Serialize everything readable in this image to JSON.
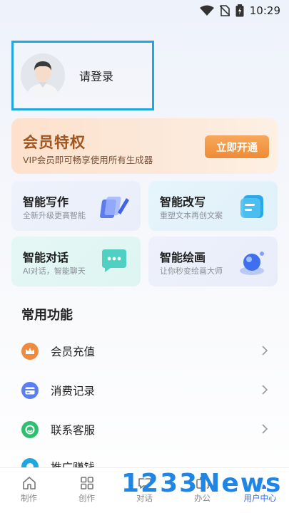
{
  "status_bar": {
    "time": "10:29"
  },
  "login": {
    "label": "请登录"
  },
  "vip": {
    "title": "会员特权",
    "subtitle": "VIP会员即可畅享使用所有生成器",
    "button": "立即开通"
  },
  "features": [
    {
      "title": "智能写作",
      "subtitle": "全新升级更高智能",
      "icon": "pen-icon"
    },
    {
      "title": "智能改写",
      "subtitle": "重塑文本再创文案",
      "icon": "document-icon"
    },
    {
      "title": "智能对话",
      "subtitle": "AI对话，智能聊天",
      "icon": "chat-icon"
    },
    {
      "title": "智能绘画",
      "subtitle": "让你秒变绘画大师",
      "icon": "paint-icon"
    }
  ],
  "common": {
    "title": "常用功能",
    "items": [
      {
        "label": "会员充值",
        "icon": "crown-icon",
        "color": "#f08a3c"
      },
      {
        "label": "消费记录",
        "icon": "card-icon",
        "color": "#5b7ff0"
      },
      {
        "label": "联系客服",
        "icon": "headset-icon",
        "color": "#2fbf71"
      },
      {
        "label": "推广赚钱",
        "icon": "money-icon",
        "color": "#1ea8df"
      }
    ]
  },
  "tabs": [
    {
      "label": "制作",
      "icon": "home-icon",
      "active": false
    },
    {
      "label": "创作",
      "icon": "grid-icon",
      "active": false
    },
    {
      "label": "对话",
      "icon": "chat-icon",
      "active": false
    },
    {
      "label": "办公",
      "icon": "office-icon",
      "active": false
    },
    {
      "label": "用户中心",
      "icon": "user-icon",
      "active": true
    }
  ],
  "watermark": "1233News",
  "colors": {
    "accent": "#2f6cf6",
    "vip_text": "#a3541d",
    "highlight_border": "#1ea8df"
  }
}
